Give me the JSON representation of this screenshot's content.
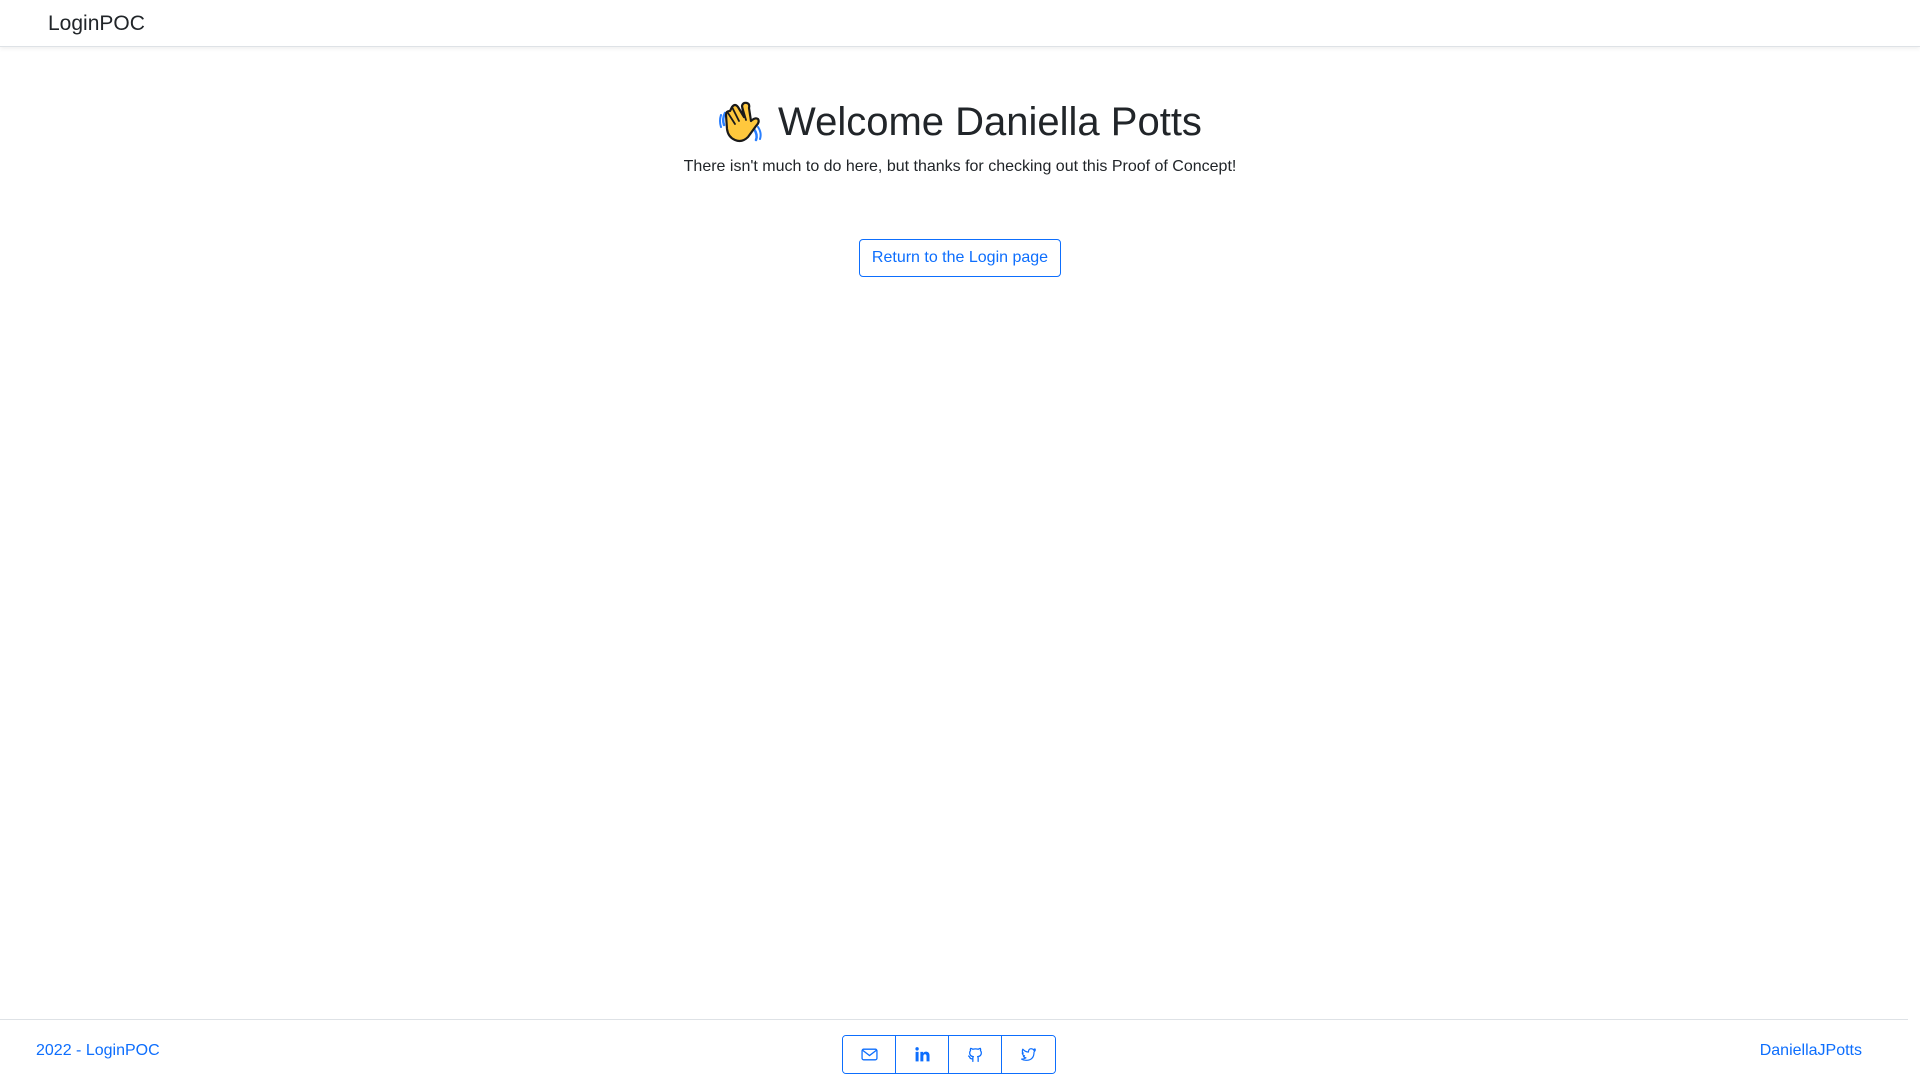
{
  "navbar": {
    "brand": "LoginPOC"
  },
  "hero": {
    "icon": "waving-hand-icon",
    "title": "Welcome Daniella Potts",
    "subtitle": "There isn't much to do here, but thanks for checking out this Proof of Concept!",
    "return_button": "Return to the Login page"
  },
  "footer": {
    "copyright": "2022 - LoginPOC",
    "author_link": "DaniellaJPotts",
    "social": [
      {
        "icon": "mail-icon"
      },
      {
        "icon": "linkedin-icon"
      },
      {
        "icon": "github-icon"
      },
      {
        "icon": "twitter-icon"
      }
    ]
  },
  "colors": {
    "accent": "#0d6efd",
    "text": "#212529",
    "border": "#dee2e6"
  }
}
